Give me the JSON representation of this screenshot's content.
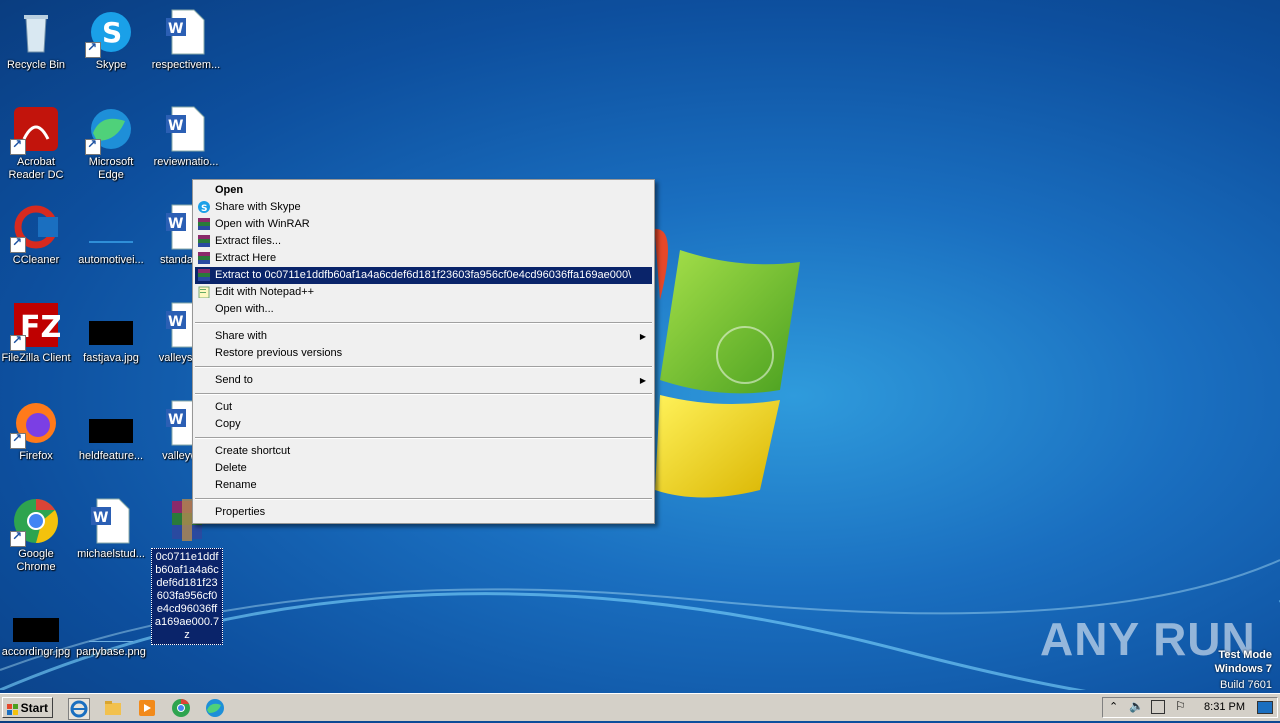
{
  "desktop": {
    "icons": [
      {
        "label": "Recycle Bin"
      },
      {
        "label": "Skype"
      },
      {
        "label": "respectivem..."
      },
      {
        "label": "Acrobat Reader DC"
      },
      {
        "label": "Microsoft Edge"
      },
      {
        "label": "reviewnatio..."
      },
      {
        "label": "CCleaner"
      },
      {
        "label": "automotivei..."
      },
      {
        "label": "standard..."
      },
      {
        "label": "FileZilla Client"
      },
      {
        "label": "fastjava.jpg"
      },
      {
        "label": "valleysim..."
      },
      {
        "label": "Firefox"
      },
      {
        "label": "heldfeature..."
      },
      {
        "label": "valleywi..."
      },
      {
        "label": "Google Chrome"
      },
      {
        "label": "michaelstud..."
      },
      {
        "label": "0c0711e1ddfb60af1a4a6cdef6d181f23603fa956cf0e4cd96036ffa169ae000.7z"
      },
      {
        "label": "accordingr.jpg"
      },
      {
        "label": "partybase.png"
      }
    ]
  },
  "context_menu": {
    "open": "Open",
    "share_skype": "Share with Skype",
    "open_winrar": "Open with WinRAR",
    "extract_files": "Extract files...",
    "extract_here": "Extract Here",
    "extract_to": "Extract to 0c0711e1ddfb60af1a4a6cdef6d181f23603fa956cf0e4cd96036ffa169ae000\\",
    "edit_notepad": "Edit with Notepad++",
    "open_with": "Open with...",
    "share_with": "Share with",
    "restore": "Restore previous versions",
    "send_to": "Send to",
    "cut": "Cut",
    "copy": "Copy",
    "create_shortcut": "Create shortcut",
    "delete": "Delete",
    "rename": "Rename",
    "properties": "Properties"
  },
  "taskbar": {
    "start": "Start",
    "clock": "8:31 PM"
  },
  "watermark": {
    "line1": "Test Mode",
    "line2": "Windows 7",
    "line3": "Build 7601"
  },
  "brand": "ANY  RUN",
  "colors": {
    "highlight": "#0a246a",
    "menu_bg": "#f0f0f0",
    "taskbar_bg": "#d4d0c8"
  }
}
